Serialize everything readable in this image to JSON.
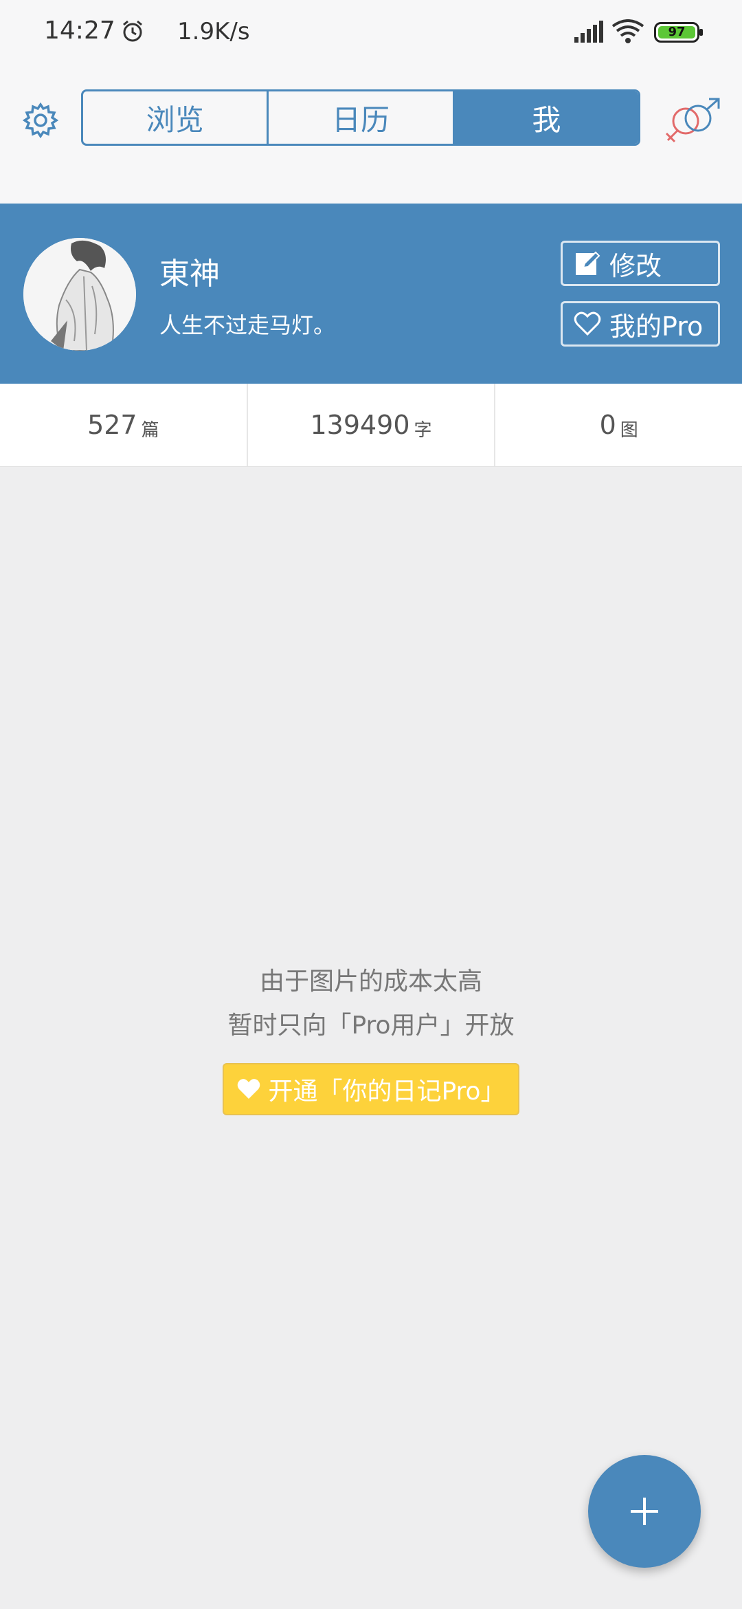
{
  "status_bar": {
    "time": "14:27",
    "net_speed": "1.9K/s",
    "battery": "97",
    "icons": [
      "alarm-icon",
      "signal-icon",
      "wifi-icon",
      "battery-icon"
    ]
  },
  "header": {
    "settings_icon": "gear-icon",
    "tabs": [
      {
        "label": "浏览",
        "active": false
      },
      {
        "label": "日历",
        "active": false
      },
      {
        "label": "我",
        "active": true
      }
    ],
    "gender_icon": "gender-icon"
  },
  "profile": {
    "name": "東神",
    "bio": "人生不过走马灯。",
    "edit_label": "修改",
    "pro_label": "我的Pro"
  },
  "stats": [
    {
      "value": "527",
      "unit": "篇"
    },
    {
      "value": "139490",
      "unit": "字"
    },
    {
      "value": "0",
      "unit": "图"
    }
  ],
  "empty_state": {
    "line1": "由于图片的成本太高",
    "line2": "暂时只向「Pro用户」开放",
    "button": "开通「你的日记Pro」"
  },
  "fab": {
    "icon": "plus-icon"
  },
  "colors": {
    "primary": "#4a88bb",
    "background": "#eeeeef",
    "pro_yellow": "#fdd23b"
  }
}
